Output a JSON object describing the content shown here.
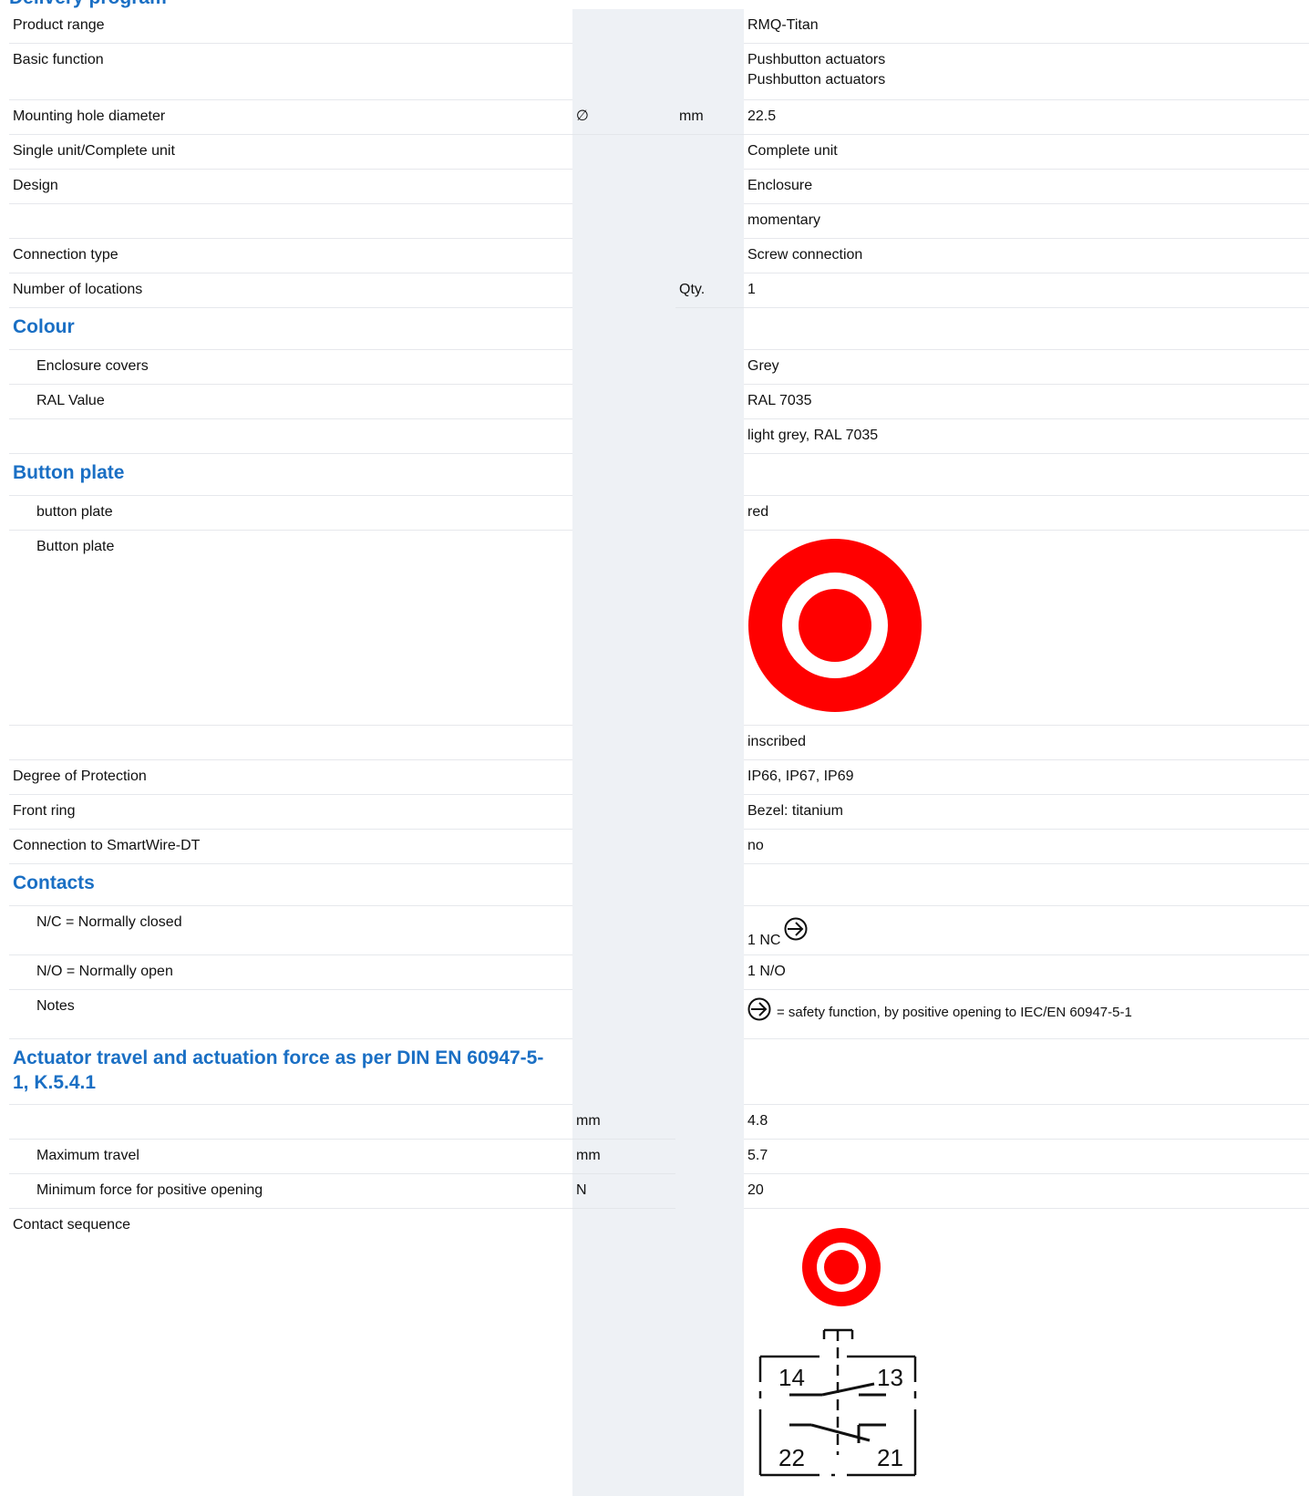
{
  "header": {
    "partial_title": "Delivery program"
  },
  "rows": {
    "product_range": {
      "label": "Product range",
      "value": "RMQ-Titan"
    },
    "basic_function": {
      "label": "Basic function",
      "value1": "Pushbutton actuators",
      "value2": "Pushbutton actuators"
    },
    "mounting_hole": {
      "label": "Mounting hole diameter",
      "symbol": "∅",
      "unit": "mm",
      "value": "22.5"
    },
    "single_complete": {
      "label": "Single unit/Complete unit",
      "value": "Complete unit"
    },
    "design": {
      "label": "Design",
      "value": "Enclosure"
    },
    "design2": {
      "value": "momentary"
    },
    "connection_type": {
      "label": "Connection type",
      "value": "Screw connection"
    },
    "locations": {
      "label": "Number of locations",
      "unit": "Qty.",
      "value": "1"
    },
    "colour_section": {
      "label": "Colour"
    },
    "enclosure_covers": {
      "label": "Enclosure covers",
      "value": "Grey"
    },
    "ral_value": {
      "label": "RAL Value",
      "value": "RAL 7035"
    },
    "ral_value2": {
      "value": "light grey, RAL 7035"
    },
    "button_plate_section": {
      "label": "Button plate"
    },
    "button_plate_color": {
      "label": "button plate",
      "value": "red"
    },
    "button_plate_image": {
      "label": "Button plate"
    },
    "inscribed": {
      "value": "inscribed"
    },
    "protection": {
      "label": "Degree of Protection",
      "value": "IP66, IP67, IP69"
    },
    "front_ring": {
      "label": "Front ring",
      "value": "Bezel: titanium"
    },
    "smartwire": {
      "label": "Connection to SmartWire-DT",
      "value": "no"
    },
    "contacts_section": {
      "label": "Contacts"
    },
    "nc": {
      "label": "N/C = Normally closed",
      "value": "1 NC"
    },
    "no": {
      "label": "N/O = Normally open",
      "value": "1 N/O"
    },
    "notes": {
      "label": "Notes",
      "value": "= safety function, by positive opening to IEC/EN 60947-5-1"
    },
    "actuator_section": {
      "label": "Actuator travel and actuation force as per DIN EN 60947-5-1, K.5.4.1"
    },
    "travel1": {
      "unit": "mm",
      "value": "4.8"
    },
    "max_travel": {
      "label": "Maximum travel",
      "unit": "mm",
      "value": "5.7"
    },
    "min_force": {
      "label": "Minimum force for positive opening",
      "unit": "N",
      "value": "20"
    },
    "contact_sequence": {
      "label": "Contact sequence",
      "terminals": {
        "t14": "14",
        "t13": "13",
        "t22": "22",
        "t21": "21"
      }
    }
  },
  "colors": {
    "accent": "#1a6fc4",
    "button_red": "#ff0000",
    "shaded_column": "#eef1f5"
  },
  "icons": {
    "positive_opening": "positive-opening-icon",
    "button_plate": "button-plate-image",
    "contact_diagram": "contact-sequence-diagram"
  }
}
